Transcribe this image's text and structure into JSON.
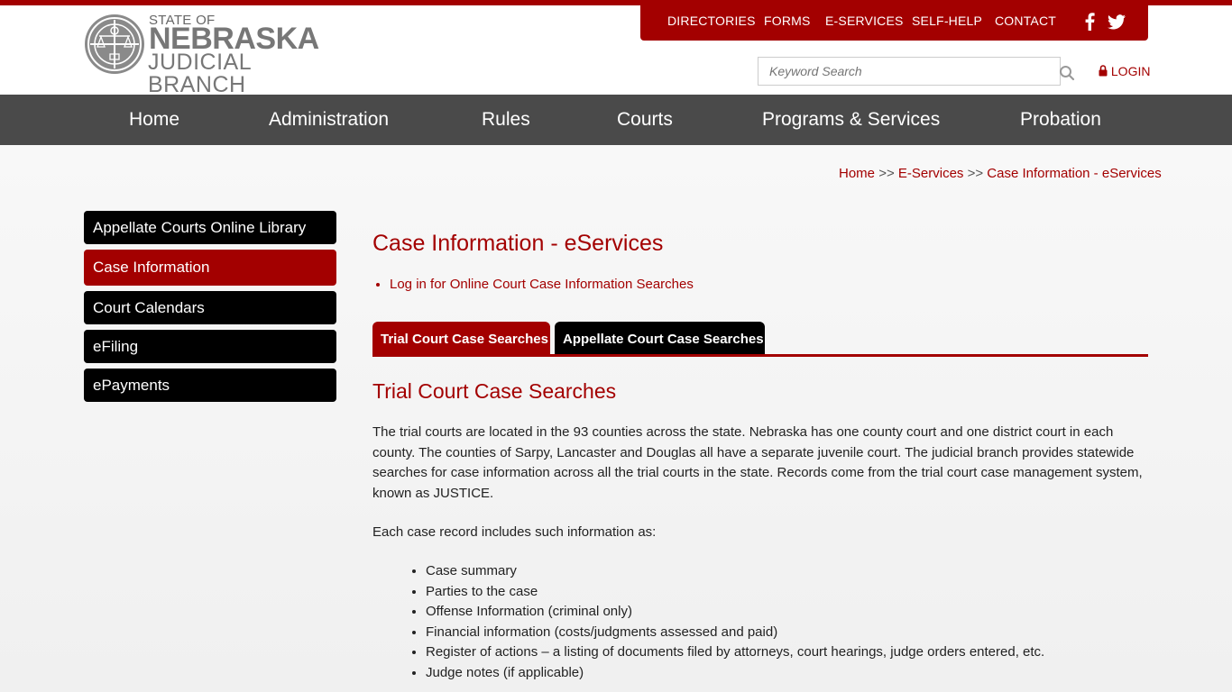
{
  "header": {
    "logo": {
      "state_of": "STATE OF",
      "nebraska": "NEBRASKA",
      "judicial_branch": "JUDICIAL BRANCH"
    },
    "utility_nav": [
      "DIRECTORIES",
      "FORMS",
      "E-SERVICES",
      "SELF-HELP",
      "CONTACT"
    ],
    "social_icons": [
      "facebook-icon",
      "twitter-icon"
    ],
    "search": {
      "placeholder": "Keyword Search",
      "value": ""
    },
    "login_label": "LOGIN"
  },
  "main_nav": [
    "Home",
    "Administration",
    "Rules",
    "Courts",
    "Programs & Services",
    "Probation"
  ],
  "breadcrumb": {
    "items": [
      "Home",
      "E-Services",
      "Case Information - eServices"
    ],
    "separator": ">>"
  },
  "sidebar": {
    "items": [
      {
        "label": "Appellate Courts Online Library",
        "active": false
      },
      {
        "label": "Case Information",
        "active": true
      },
      {
        "label": "Court Calendars",
        "active": false
      },
      {
        "label": "eFiling",
        "active": false
      },
      {
        "label": "ePayments",
        "active": false
      }
    ]
  },
  "content": {
    "title": "Case Information - eServices",
    "login_link": "Log in for Online Court Case Information Searches",
    "tabs": [
      {
        "label": "Trial Court Case Searches",
        "active": true
      },
      {
        "label": "Appellate Court Case Searches",
        "active": false
      }
    ],
    "section_title": "Trial Court Case Searches",
    "paragraph1": "The trial courts are located in the 93 counties across the state.  Nebraska has one county court and one district court in each county.  The counties of Sarpy, Lancaster and Douglas all have a separate juvenile court.  The judicial branch provides statewide searches for case information across all the trial courts in the state.  Records come from the trial court case management system, known as JUSTICE.",
    "paragraph2": "Each case record includes such information as:",
    "info_list": [
      "Case summary",
      "Parties to the case",
      "Offense Information (criminal only)",
      "Financial information (costs/judgments assessed and paid)",
      "Register of actions – a listing of documents filed by attorneys, court hearings, judge orders entered, etc.",
      "Judge notes (if applicable)"
    ]
  },
  "colors": {
    "brand_red": "#a30000",
    "nav_gray": "#4a4a4a",
    "sidebar_black": "#000000"
  }
}
